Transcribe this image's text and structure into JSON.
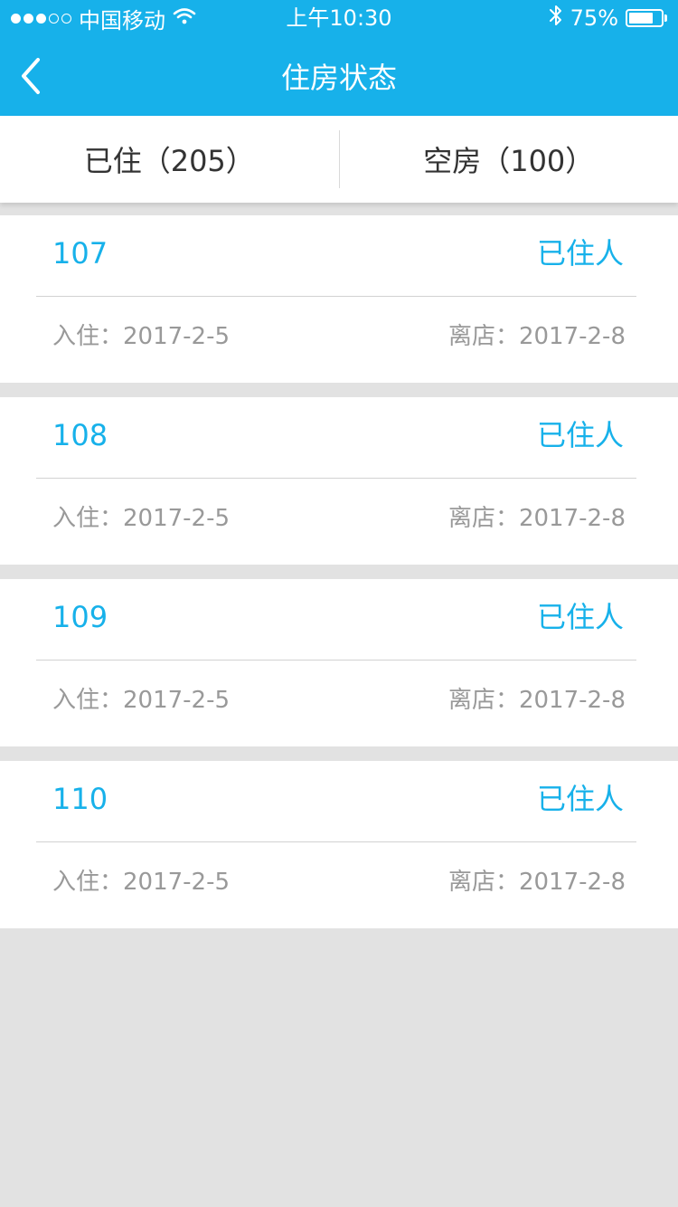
{
  "status_bar": {
    "carrier": "中国移动",
    "time": "上午10:30",
    "battery_percent": "75%",
    "battery_level": 0.75,
    "signal_filled": 3,
    "signal_total": 5
  },
  "nav": {
    "title": "住房状态",
    "back_icon": "chevron-left-icon"
  },
  "tabs": [
    {
      "label": "已住（205）",
      "active": true
    },
    {
      "label": "空房（100）",
      "active": false
    }
  ],
  "rooms": [
    {
      "number": "107",
      "status": "已住人",
      "checkin": "入住：2017-2-5",
      "checkout": "离店：2017-2-8"
    },
    {
      "number": "108",
      "status": "已住人",
      "checkin": "入住：2017-2-5",
      "checkout": "离店：2017-2-8"
    },
    {
      "number": "109",
      "status": "已住人",
      "checkin": "入住：2017-2-5",
      "checkout": "离店：2017-2-8"
    },
    {
      "number": "110",
      "status": "已住人",
      "checkin": "入住：2017-2-5",
      "checkout": "离店：2017-2-8"
    }
  ],
  "colors": {
    "accent": "#17b1ea",
    "background": "#e2e2e2",
    "card": "#ffffff",
    "muted_text": "#999999"
  }
}
